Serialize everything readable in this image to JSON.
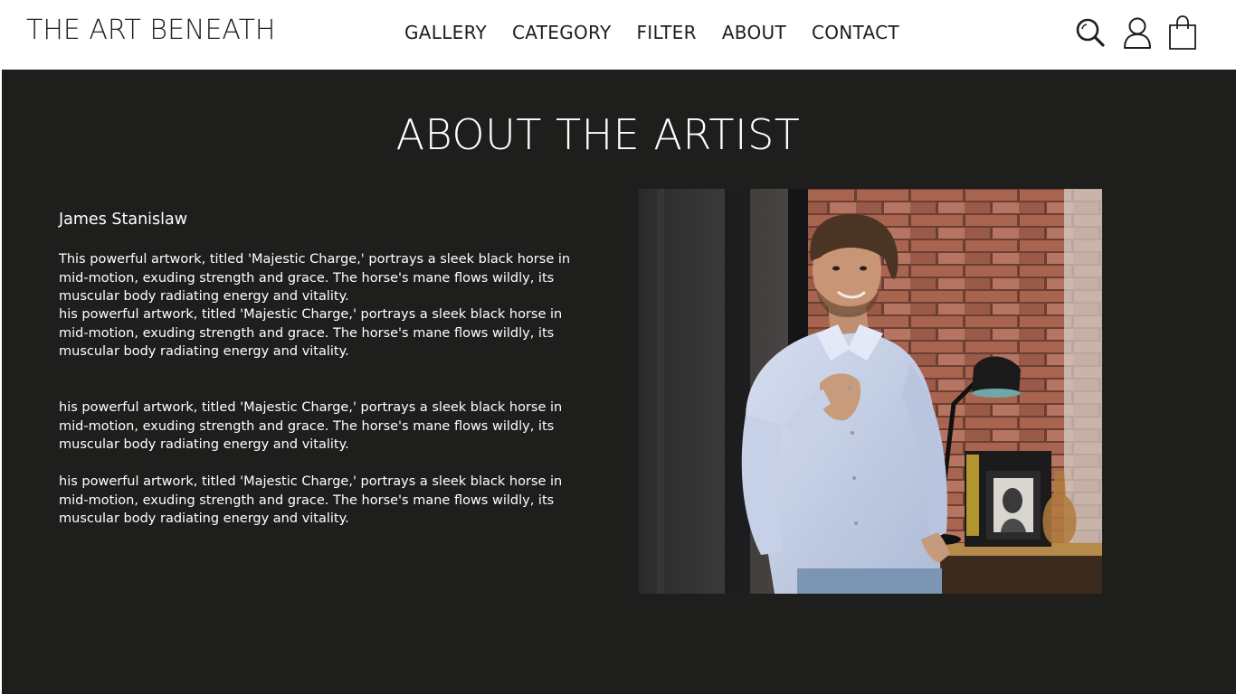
{
  "header": {
    "brand": "THE ART BENEATH",
    "nav": [
      "GALLERY",
      "CATEGORY",
      "FILTER",
      "ABOUT",
      "CONTACT"
    ],
    "icons": [
      "search-icon",
      "user-icon",
      "shopping-bag-icon"
    ]
  },
  "about": {
    "title": "ABOUT THE ARTIST",
    "artist_name": "James Stanislaw",
    "paragraphs": [
      "This powerful artwork, titled 'Majestic Charge,' portrays a sleek black horse in mid-motion, exuding strength and grace. The horse's mane flows wildly, its muscular body radiating energy and vitality.",
      "his powerful artwork, titled 'Majestic Charge,' portrays a sleek black horse in mid-motion, exuding strength and grace. The horse's mane flows wildly, its muscular body radiating energy and vitality.",
      "his powerful artwork, titled 'Majestic Charge,' portrays a sleek black horse in mid-motion, exuding strength and grace. The horse's mane flows wildly, its muscular body radiating energy and vitality.",
      "his powerful artwork, titled 'Majestic Charge,' portrays a sleek black horse in mid-motion, exuding strength and grace. The horse's mane flows wildly, its muscular body radiating energy and vitality."
    ]
  },
  "colors": {
    "background": "#1e1e1d",
    "header_bg": "#ffffff",
    "text_dark": "#1e1e1c",
    "text_light": "#ffffff"
  }
}
